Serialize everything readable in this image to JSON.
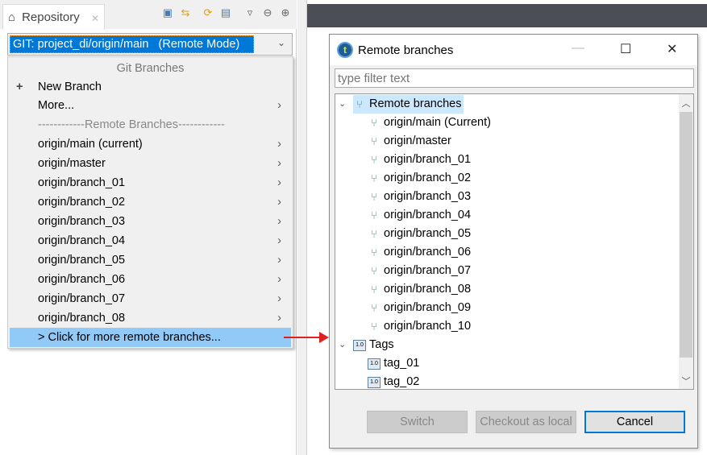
{
  "repo_tab": {
    "title": "Repository",
    "icon": "home-icon"
  },
  "combo": {
    "value": "GIT: project_di/origin/main   (Remote Mode)"
  },
  "menu": {
    "header": "Git Branches",
    "new_branch": "New Branch",
    "more": "More...",
    "separator": "------------Remote Branches------------",
    "branches": [
      "origin/main (current)",
      "origin/master",
      "origin/branch_01",
      "origin/branch_02",
      "origin/branch_03",
      "origin/branch_04",
      "origin/branch_05",
      "origin/branch_06",
      "origin/branch_07",
      "origin/branch_08"
    ],
    "more_remote": "> Click for more remote branches..."
  },
  "dialog": {
    "title": "Remote branches",
    "filter_placeholder": "type filter text",
    "root": "Remote branches",
    "branches": [
      "origin/main (Current)",
      "origin/master",
      "origin/branch_01",
      "origin/branch_02",
      "origin/branch_03",
      "origin/branch_04",
      "origin/branch_05",
      "origin/branch_06",
      "origin/branch_07",
      "origin/branch_08",
      "origin/branch_09",
      "origin/branch_10"
    ],
    "tags_label": "Tags",
    "tags": [
      "tag_01",
      "tag_02"
    ],
    "buttons": {
      "switch": "Switch",
      "checkout": "Checkout as local",
      "cancel": "Cancel"
    }
  }
}
